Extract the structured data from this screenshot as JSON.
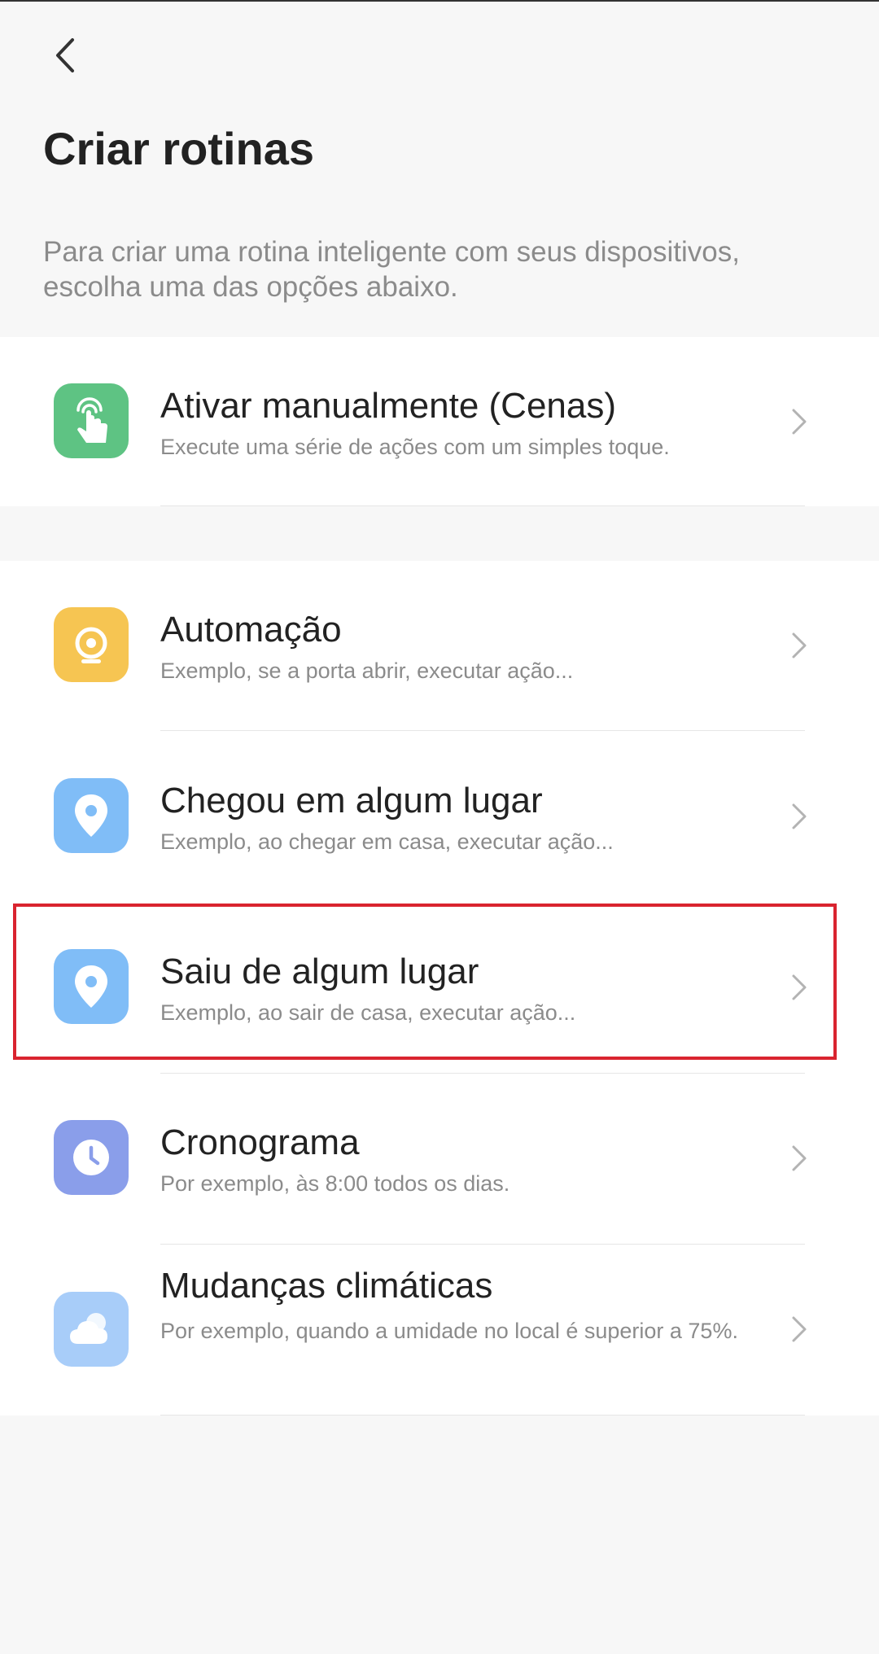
{
  "header": {
    "back_icon": "chevron-left-icon",
    "title": "Criar rotinas",
    "description": "Para criar uma rotina inteligente com seus dispositivos, escolha uma das opções abaixo."
  },
  "options": [
    {
      "title": "Ativar manualmente (Cenas)",
      "subtitle": "Execute uma série de ações com um simples toque.",
      "icon": "tap-hand-icon",
      "color": "#5ec383"
    },
    {
      "title": "Automação",
      "subtitle": "Exemplo, se a porta abrir, executar ação...",
      "icon": "sensor-icon",
      "color": "#f6c552"
    },
    {
      "title": "Chegou em algum lugar",
      "subtitle": "Exemplo, ao chegar em casa, executar ação...",
      "icon": "location-pin-icon",
      "color": "#80bdf7"
    },
    {
      "title": "Saiu de algum lugar",
      "subtitle": "Exemplo, ao sair de casa, executar ação...",
      "icon": "location-pin-icon",
      "color": "#80bdf7"
    },
    {
      "title": "Cronograma",
      "subtitle": "Por exemplo, às 8:00 todos os dias.",
      "icon": "clock-icon",
      "color": "#8a9eea"
    },
    {
      "title": "Mudanças climáticas",
      "subtitle": "Por exemplo, quando a umidade no local é superior a 75%.",
      "icon": "weather-icon",
      "color": "#a8cdf9"
    }
  ],
  "colors": {
    "background": "#f7f7f7",
    "card": "#ffffff",
    "highlight": "#d9242f"
  }
}
